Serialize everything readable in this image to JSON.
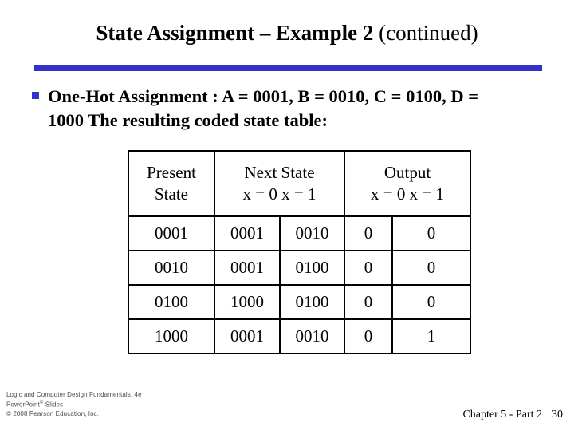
{
  "slide": {
    "title_bold": "State Assignment – Example 2",
    "title_regular": "(continued)",
    "accent_color": "#3333CC"
  },
  "bullet": {
    "marker": "square-bullet",
    "text": "One-Hot Assignment : A = 0001, B = 0010, C = 0100, D = 1000 The resulting coded state table:"
  },
  "table": {
    "headers": {
      "present_state_line1": "Present",
      "present_state_line2": "State",
      "next_state_main": "Next State",
      "next_state_sub": "x = 0 x = 1",
      "output_main": "Output",
      "output_sub": "x = 0 x = 1"
    },
    "rows": [
      {
        "present_state": "0001",
        "next_x0": "0001",
        "next_x1": "0010",
        "out_x0": "0",
        "out_x1": "0"
      },
      {
        "present_state": "0010",
        "next_x0": "0001",
        "next_x1": "0100",
        "out_x0": "0",
        "out_x1": "0"
      },
      {
        "present_state": "0100",
        "next_x0": "1000",
        "next_x1": "0100",
        "out_x0": "0",
        "out_x1": "0"
      },
      {
        "present_state": "1000",
        "next_x0": "0001",
        "next_x1": "0010",
        "out_x0": "0",
        "out_x1": "1"
      }
    ]
  },
  "footer": {
    "left_line1": "Logic and Computer Design Fundamentals, 4e",
    "left_line2_pre": "PowerPoint",
    "left_line2_sup": "®",
    "left_line2_post": " Slides",
    "left_line3": "© 2008 Pearson Education, Inc.",
    "chapter": "Chapter 5 - Part 2",
    "page_number": "30"
  }
}
